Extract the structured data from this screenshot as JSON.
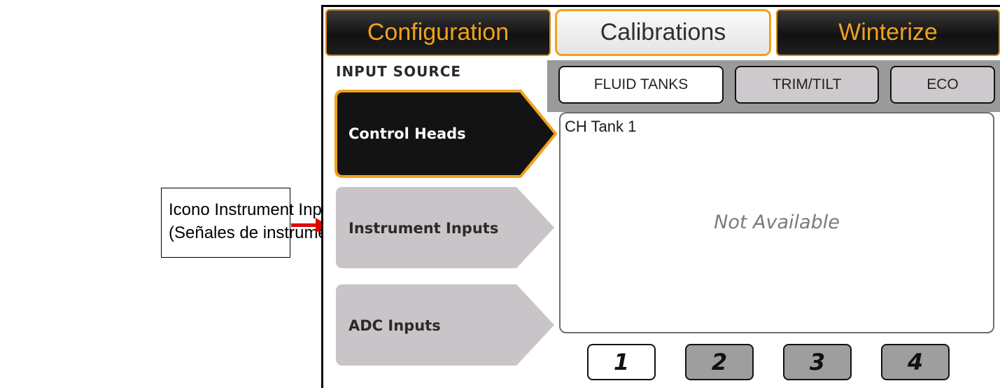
{
  "annotation": {
    "line1": "Icono Instrument Inputs",
    "line2": "(Señales de instrumentos)"
  },
  "top_tabs": [
    {
      "label": "Configuration",
      "state": "inactive"
    },
    {
      "label": "Calibrations",
      "state": "selected"
    },
    {
      "label": "Winterize",
      "state": "inactive"
    }
  ],
  "input_source": {
    "heading": "INPUT SOURCE",
    "items": [
      {
        "label": "Control Heads",
        "state": "selected"
      },
      {
        "label": "Instrument Inputs",
        "state": "inactive"
      },
      {
        "label": "ADC Inputs",
        "state": "inactive"
      }
    ]
  },
  "sub_tabs": [
    {
      "label": "FLUID TANKS",
      "state": "selected"
    },
    {
      "label": "TRIM/TILT",
      "state": "inactive"
    },
    {
      "label": "ECO",
      "state": "inactive"
    }
  ],
  "panel": {
    "title": "CH Tank 1",
    "status": "Not Available"
  },
  "pages": [
    {
      "label": "1",
      "state": "selected"
    },
    {
      "label": "2",
      "state": "inactive"
    },
    {
      "label": "3",
      "state": "inactive"
    },
    {
      "label": "4",
      "state": "inactive"
    }
  ],
  "colors": {
    "accent_orange": "#f2a11c",
    "arrow_red": "#e00000",
    "dark_button": "#141414",
    "inactive_button": "#c8c4c8"
  }
}
